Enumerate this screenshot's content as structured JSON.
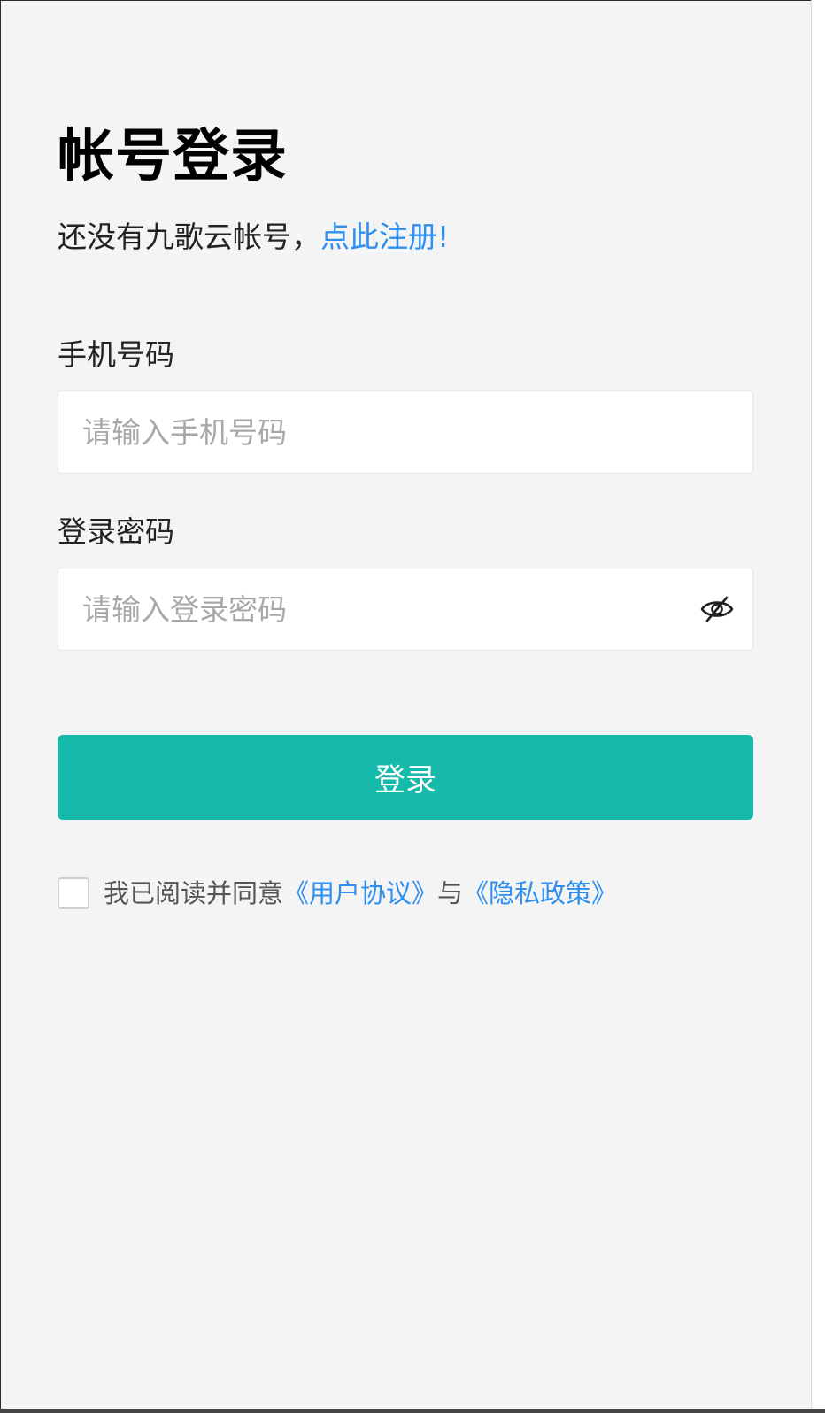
{
  "header": {
    "title": "帐号登录",
    "subtitle_prefix": "还没有九歌云帐号，",
    "register_link": "点此注册!"
  },
  "form": {
    "phone": {
      "label": "手机号码",
      "placeholder": "请输入手机号码",
      "value": ""
    },
    "password": {
      "label": "登录密码",
      "placeholder": "请输入登录密码",
      "value": "",
      "toggle_icon": "eye-slash-icon"
    },
    "submit_label": "登录"
  },
  "agreement": {
    "checked": false,
    "prefix": "我已阅读并同意",
    "user_agreement": "《用户协议》",
    "connector": "与",
    "privacy_policy": "《隐私政策》"
  },
  "colors": {
    "accent": "#16baaa",
    "link": "#2f8ff0",
    "background": "#f4f4f4"
  }
}
